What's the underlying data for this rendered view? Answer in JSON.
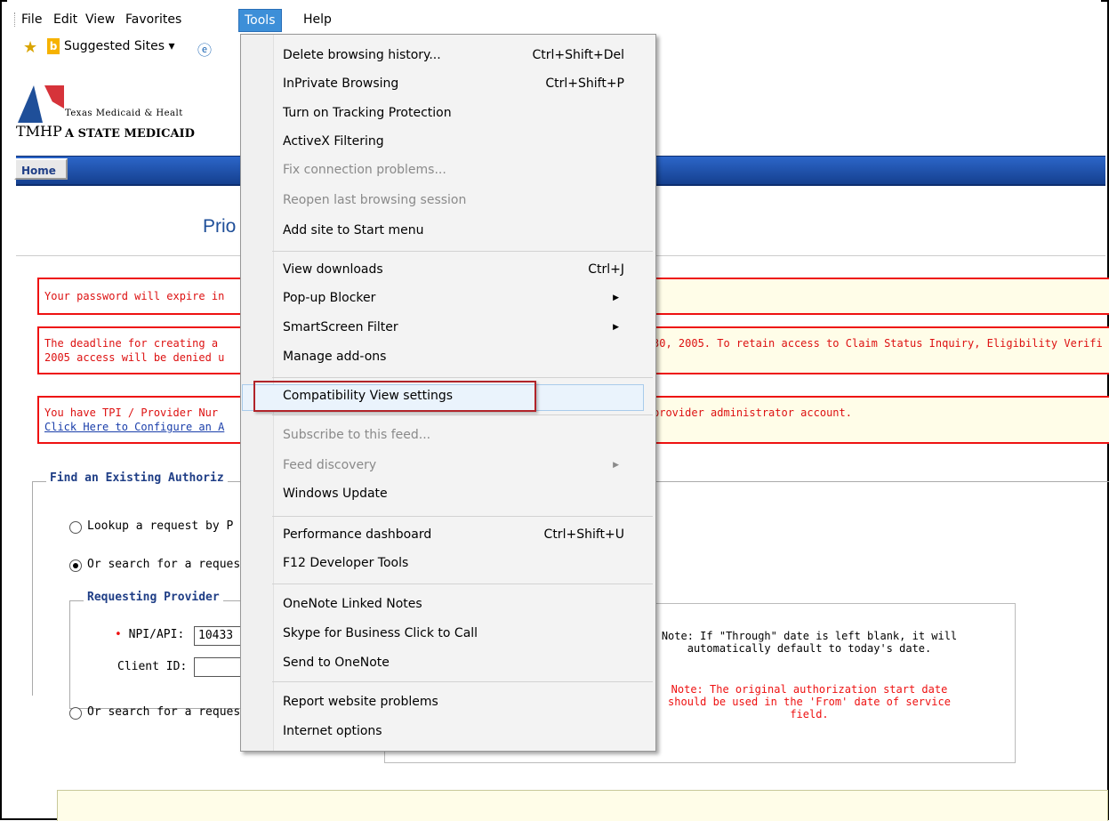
{
  "menubar": {
    "items": [
      "File",
      "Edit",
      "View",
      "Favorites",
      "Tools",
      "Help"
    ]
  },
  "favorites": {
    "suggested": "Suggested Sites ▾"
  },
  "header": {
    "logo": "TMHP",
    "org_small": "Texas Medicaid & Healt",
    "org_big": "A STATE MEDICAID"
  },
  "nav": {
    "home": "Home"
  },
  "page": {
    "title_fragment": "Prio"
  },
  "alerts": {
    "password": "Your password will expire in",
    "deadline_left": "The deadline for creating a",
    "deadline_right": "30, 2005. To retain access to Claim Status Inquiry, Eligibility Verifi",
    "deadline_line2": "2005 access will be denied u",
    "tpi_left": "You have TPI / Provider Nur",
    "tpi_right": "provider administrator account.",
    "tpi_link": "Click Here to Configure an A"
  },
  "find": {
    "legend": "Find an Existing Authoriz",
    "radio1": "Lookup a request by P",
    "radio2": "Or search for a reques",
    "radio3": "Or search for a request by facility or performing provider"
  },
  "provider": {
    "legend": "Requesting Provider",
    "npi_label": "NPI/API:",
    "npi_value": "10433",
    "client_label": "Client ID:"
  },
  "notes": {
    "note1": "Note: If \"Through\" date is left blank, it will automatically default to today's date.",
    "note2": "Note: The original authorization start date should be used in the 'From' date of service field."
  },
  "tools_menu": {
    "items": [
      {
        "label": "Delete browsing history...",
        "shortcut": "Ctrl+Shift+Del"
      },
      {
        "label": "InPrivate Browsing",
        "shortcut": "Ctrl+Shift+P"
      },
      {
        "label": "Turn on Tracking Protection"
      },
      {
        "label": "ActiveX Filtering"
      },
      {
        "label": "Fix connection problems..."
      },
      {
        "label": "Reopen last browsing session"
      },
      {
        "label": "Add site to Start menu"
      },
      {
        "label": "View downloads",
        "shortcut": "Ctrl+J"
      },
      {
        "label": "Pop-up Blocker"
      },
      {
        "label": "SmartScreen Filter"
      },
      {
        "label": "Manage add-ons"
      },
      {
        "label": "Compatibility View settings"
      },
      {
        "label": "Subscribe to this feed..."
      },
      {
        "label": "Feed discovery"
      },
      {
        "label": "Windows Update"
      },
      {
        "label": "Performance dashboard",
        "shortcut": "Ctrl+Shift+U"
      },
      {
        "label": "F12 Developer Tools"
      },
      {
        "label": "OneNote Linked Notes"
      },
      {
        "label": "Skype for Business Click to Call"
      },
      {
        "label": "Send to OneNote"
      },
      {
        "label": "Report website problems"
      },
      {
        "label": "Internet options"
      }
    ]
  }
}
